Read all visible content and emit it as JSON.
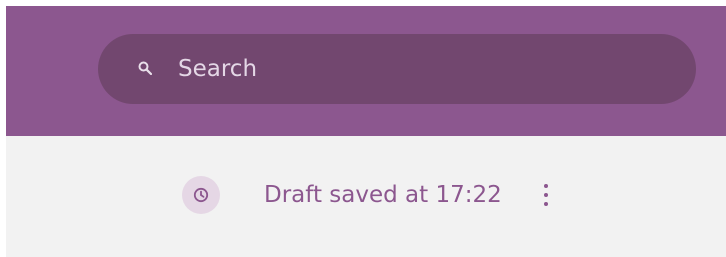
{
  "header": {
    "background_color": "#8c578f"
  },
  "search": {
    "placeholder": "Search",
    "icon": "search-icon"
  },
  "status": {
    "text": "Draft saved at 17:22",
    "icon": "clock-icon",
    "menu_icon": "more-vertical-icon",
    "text_color": "#8c578f"
  }
}
